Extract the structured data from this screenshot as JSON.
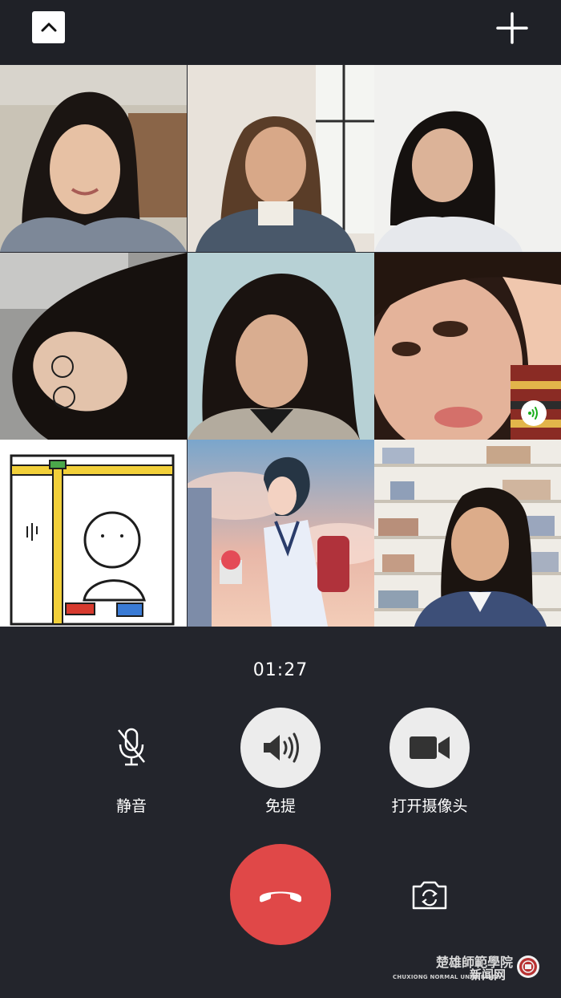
{
  "header": {
    "collapse_icon": "chevron-up-icon",
    "add_icon": "plus-icon"
  },
  "participants": [
    {
      "id": "p1",
      "type": "video",
      "speaking": false
    },
    {
      "id": "p2",
      "type": "video",
      "speaking": false
    },
    {
      "id": "p3",
      "type": "video",
      "speaking": false
    },
    {
      "id": "p4",
      "type": "video",
      "speaking": false
    },
    {
      "id": "p5",
      "type": "video",
      "speaking": false
    },
    {
      "id": "p6",
      "type": "avatar-image",
      "speaking": true
    },
    {
      "id": "p7",
      "type": "avatar-image",
      "speaking": false
    },
    {
      "id": "p8",
      "type": "avatar-image",
      "speaking": false
    },
    {
      "id": "p9",
      "type": "video",
      "speaking": false
    }
  ],
  "call": {
    "timer": "01:27"
  },
  "controls": {
    "mute": {
      "label": "静音",
      "icon": "microphone-muted-icon",
      "active": false
    },
    "speaker": {
      "label": "免提",
      "icon": "speaker-icon",
      "active": true
    },
    "camera": {
      "label": "打开摄像头",
      "icon": "video-camera-icon",
      "active": true
    },
    "hangup_icon": "phone-hangup-icon",
    "flip_camera_icon": "camera-flip-icon"
  },
  "watermark": {
    "name_cn": "楚雄師範學院",
    "name_en": "CHUXIONG NORMAL UNIVERSITY",
    "section": "新闻网"
  },
  "colors": {
    "background": "#23252c",
    "hangup": "#e04848",
    "speaking_indicator": "#1aad19"
  }
}
